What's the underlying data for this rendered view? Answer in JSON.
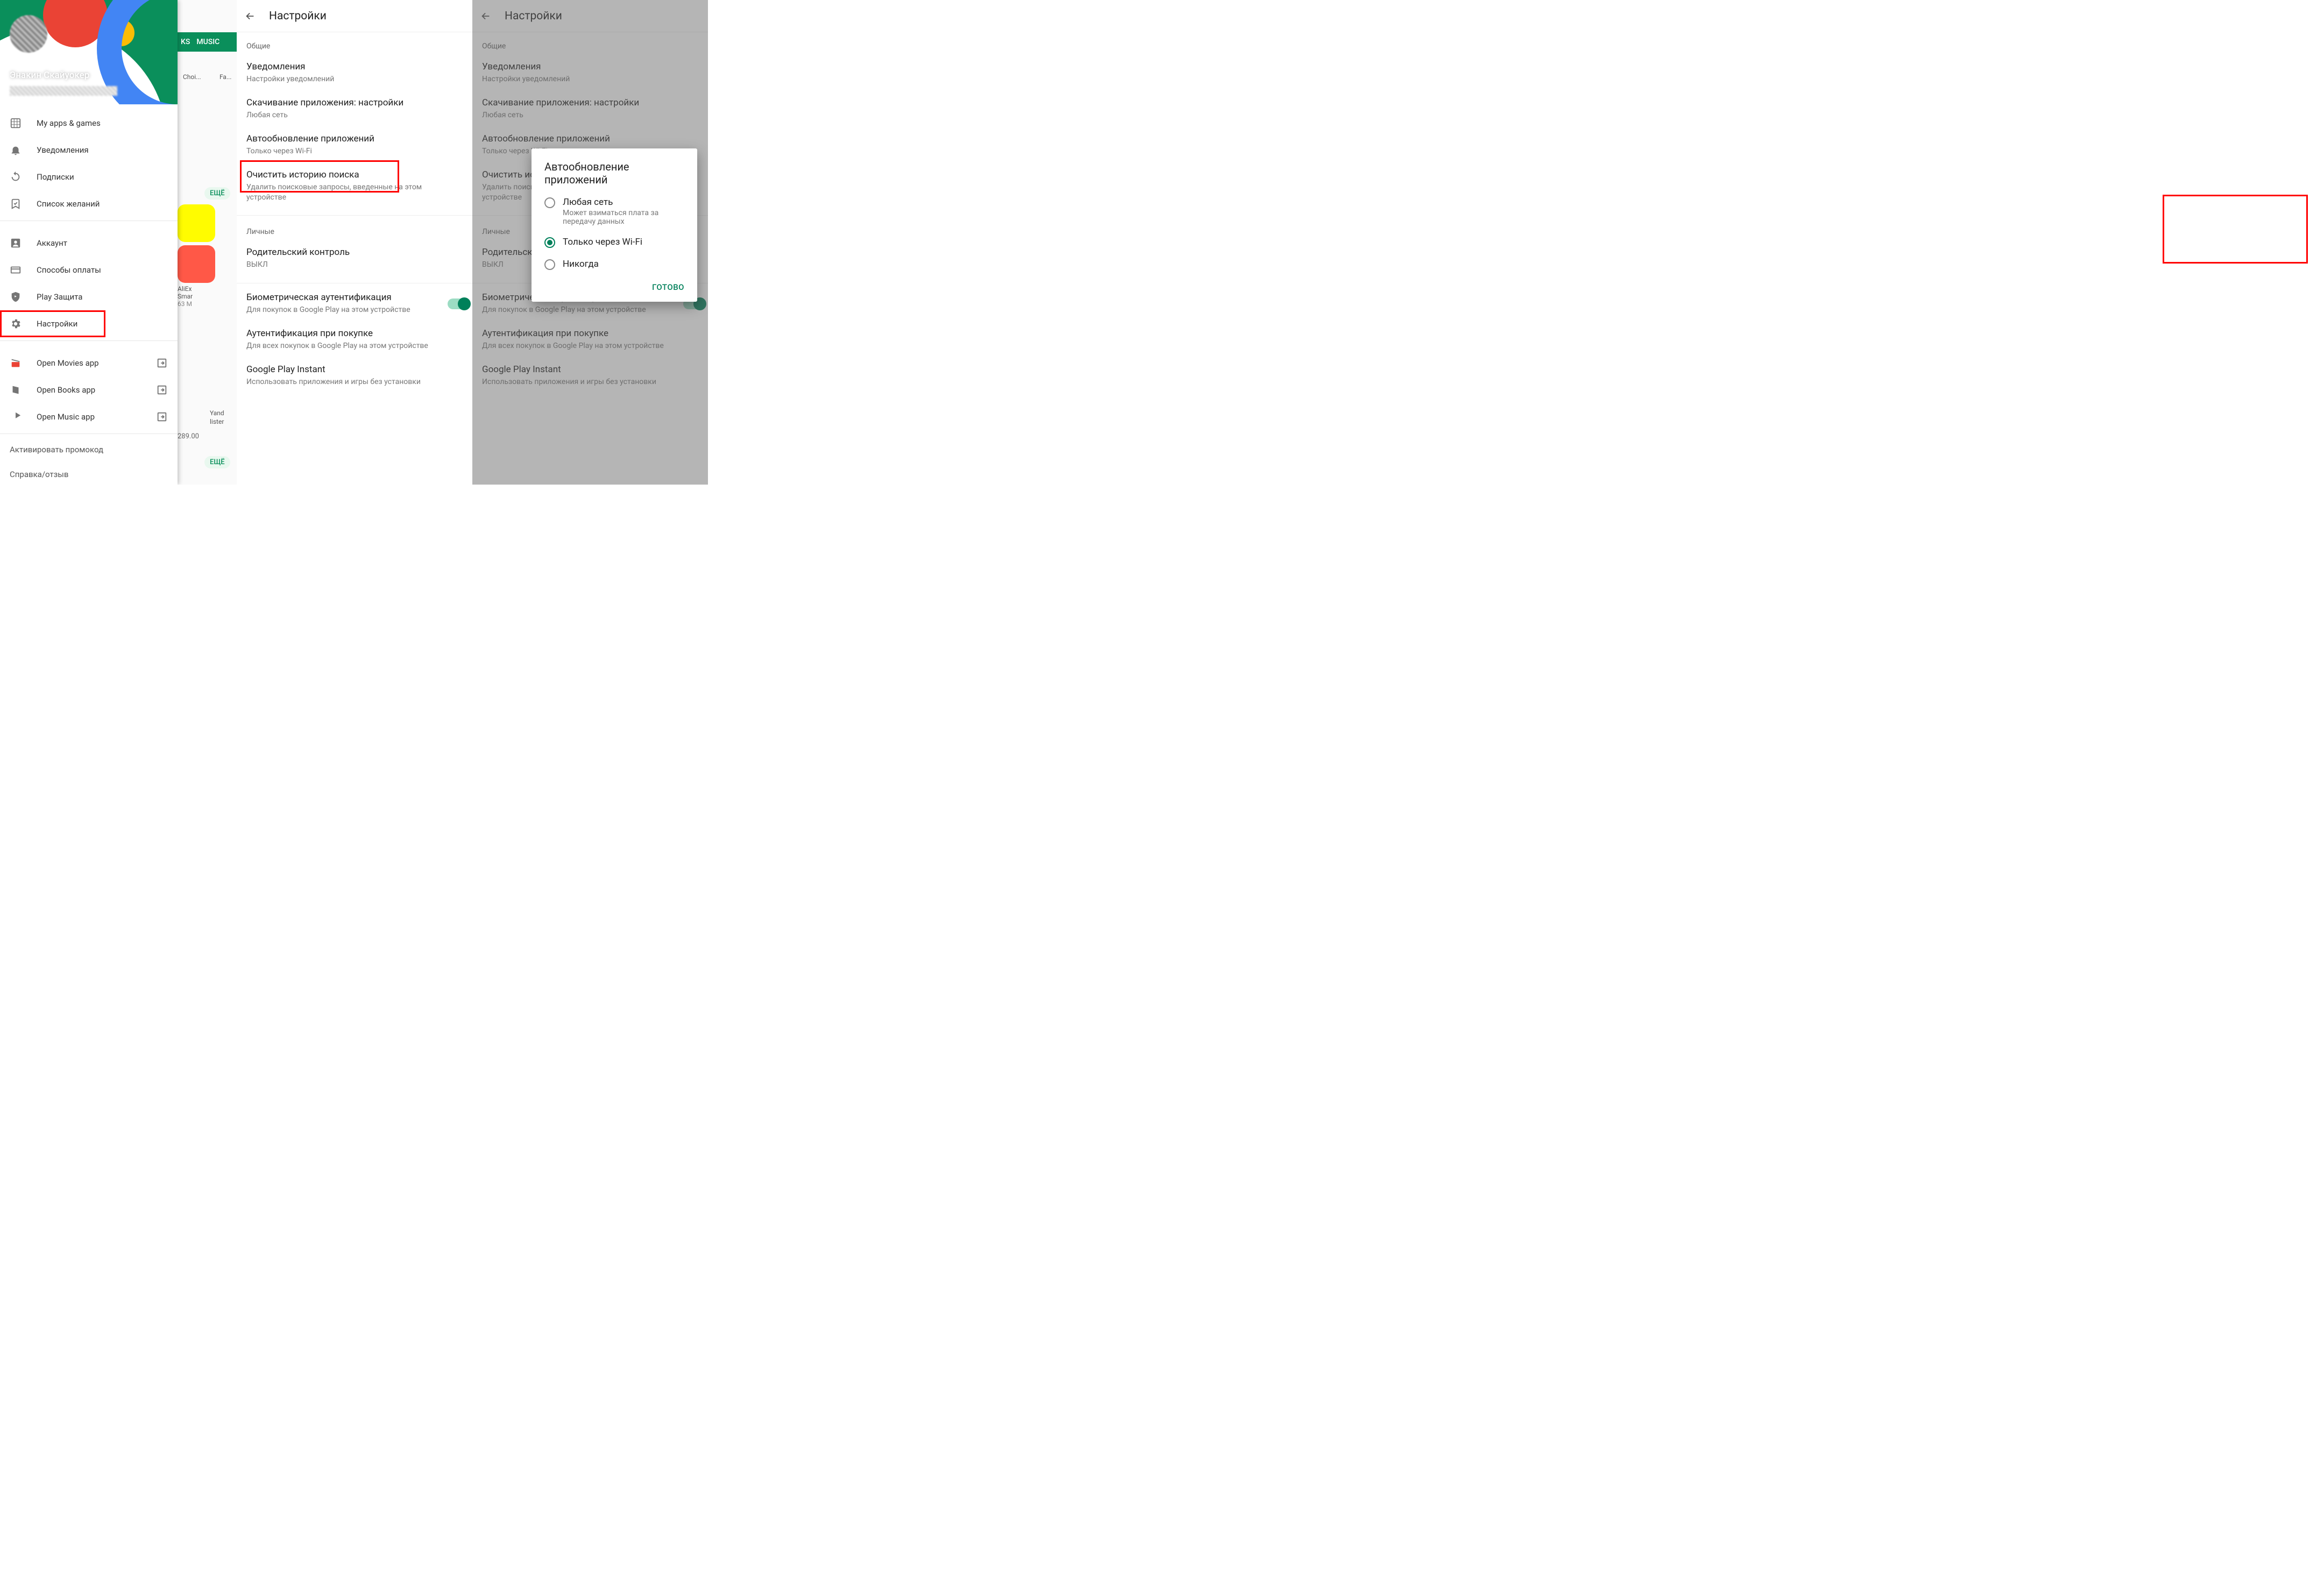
{
  "drawer": {
    "profile_name": "Энакин Скайуокер",
    "items": [
      {
        "label": "My apps & games",
        "icon": "apps"
      },
      {
        "label": "Уведомления",
        "icon": "bell"
      },
      {
        "label": "Подписки",
        "icon": "refresh"
      },
      {
        "label": "Список желаний",
        "icon": "bookmark"
      }
    ],
    "items2": [
      {
        "label": "Аккаунт",
        "icon": "account"
      },
      {
        "label": "Способы оплаты",
        "icon": "card"
      },
      {
        "label": "Play Защита",
        "icon": "shield"
      },
      {
        "label": "Настройки",
        "icon": "gear",
        "highlight": true
      }
    ],
    "items3": [
      {
        "label": "Open Movies app",
        "icon": "movies",
        "color": "#ea4335",
        "external": true
      },
      {
        "label": "Open Books app",
        "icon": "books",
        "color": "#4285f4",
        "external": true
      },
      {
        "label": "Open Music app",
        "icon": "music",
        "color": "#fb8c00",
        "external": true
      }
    ],
    "bottom": {
      "promo": "Активировать промокод",
      "help": "Справка/отзыв"
    }
  },
  "store_bg": {
    "tabs": [
      "KS",
      "MUSIC"
    ],
    "chip": "ЕЩЁ",
    "app1_name": "AliEx",
    "app1_sub": "Smar",
    "app1_size": "63 M",
    "app2_name": "Yand",
    "app2_sub": "lister",
    "price": "289.00",
    "choi": "Choi...",
    "fam": "Fa..."
  },
  "settings": {
    "title": "Настройки",
    "section_general": "Общие",
    "notifications_t": "Уведомления",
    "notifications_s": "Настройки уведомлений",
    "download_t": "Скачивание приложения: настройки",
    "download_s": "Любая сеть",
    "autoupdate_t": "Автообновление приложений",
    "autoupdate_s": "Только через Wi-Fi",
    "clear_t": "Очистить историю поиска",
    "clear_s": "Удалить поисковые запросы, введенные на этом устройстве",
    "section_personal": "Личные",
    "parental_t": "Родительский контроль",
    "parental_s": "ВЫКЛ",
    "biometric_t": "Биометрическая аутентификация",
    "biometric_s": "Для покупок в Google Play на этом устройстве",
    "auth_t": "Аутентификация при покупке",
    "auth_s": "Для всех покупок в Google Play на этом устройстве",
    "instant_t": "Google Play Instant",
    "instant_s": "Использовать приложения и игры без установки"
  },
  "dialog": {
    "title": "Автообновление приложений",
    "opt1_t": "Любая сеть",
    "opt1_s": "Может взиматься плата за передачу данных",
    "opt2_t": "Только через Wi-Fi",
    "opt3_t": "Никогда",
    "done": "ГОТОВО"
  }
}
